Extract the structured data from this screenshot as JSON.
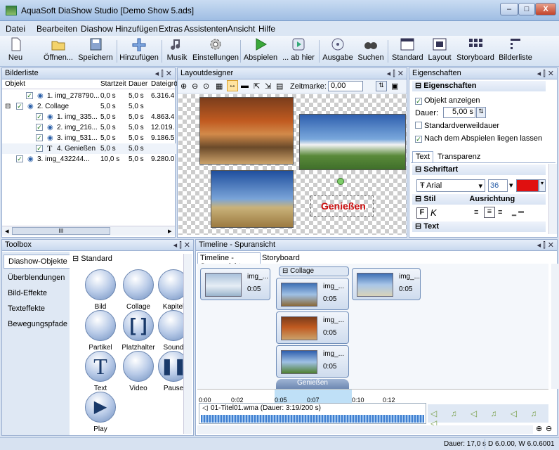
{
  "window": {
    "title": "AquaSoft DiaShow Studio [Demo Show 5.ads]",
    "min": "–",
    "max": "□",
    "close": "X"
  },
  "menu": [
    "Datei",
    "Bearbeiten",
    "Diashow",
    "Hinzufügen",
    "Extras",
    "Assistenten",
    "Ansicht",
    "Hilfe"
  ],
  "toolbar": {
    "neu": "Neu",
    "oeffnen": "Öffnen...",
    "speichern": "Speichern",
    "hinzufuegen": "Hinzufügen",
    "musik": "Musik",
    "einstellungen": "Einstellungen",
    "abspielen": "Abspielen",
    "abhier": "... ab hier",
    "ausgabe": "Ausgabe",
    "suchen": "Suchen",
    "standard": "Standard",
    "layout": "Layout",
    "storyboard": "Storyboard",
    "bilderliste": "Bilderliste"
  },
  "bilderliste": {
    "title": "Bilderliste",
    "controls": "◂ ⫿ ✕",
    "cols": [
      "Objekt",
      "Startzeit",
      "Dauer",
      "Dateigrö"
    ],
    "rows": [
      {
        "name": "1. img_278790...",
        "start": "0,0 s",
        "dur": "5,0 s",
        "size": "6.316.4"
      },
      {
        "name": "2. Collage",
        "start": "5,0 s",
        "dur": "5,0 s",
        "size": ""
      },
      {
        "name": "1. img_335...",
        "start": "5,0 s",
        "dur": "5,0 s",
        "size": "4.863.4"
      },
      {
        "name": "2. img_216...",
        "start": "5,0 s",
        "dur": "5,0 s",
        "size": "12.019."
      },
      {
        "name": "3. img_531...",
        "start": "5,0 s",
        "dur": "5,0 s",
        "size": "9.186.5"
      },
      {
        "name": "4. Genießen",
        "start": "5,0 s",
        "dur": "5,0 s",
        "size": ""
      },
      {
        "name": "3. img_432244...",
        "start": "10,0 s",
        "dur": "5,0 s",
        "size": "9.280.0"
      }
    ],
    "scroll": "III"
  },
  "layoutdesigner": {
    "title": "Layoutdesigner",
    "controls": "◂ ⫿ ✕",
    "zeitmarke_label": "Zeitmarke:",
    "zeitmarke": "0,00",
    "text_object": "Genießen"
  },
  "eigenschaften": {
    "title": "Eigenschaften",
    "controls": "◂ ⫿ ✕",
    "section": "Eigenschaften",
    "objekt_anzeigen": "Objekt anzeigen",
    "dauer_label": "Dauer:",
    "dauer": "5,00 s",
    "standard": "Standardverweildauer",
    "liegen": "Nach dem Abspielen liegen lassen",
    "tab_text": "Text",
    "tab_transparenz": "Transparenz",
    "schriftart": "Schriftart",
    "font": "Arial",
    "size": "36",
    "stil": "Stil",
    "ausrichtung": "Ausrichtung",
    "text": "Text",
    "color": "#e01010"
  },
  "toolbox": {
    "title": "Toolbox",
    "controls": "◂ ⫿ ✕",
    "tabs": [
      "Diashow-Objekte",
      "Überblendungen",
      "Bild-Effekte",
      "Texteffekte",
      "Bewegungspfade"
    ],
    "group": "Standard",
    "tools": [
      "Bild",
      "Collage",
      "Kapitel",
      "Partikel",
      "Platzhalter",
      "Sound",
      "Text",
      "Video",
      "Pause",
      "Play"
    ]
  },
  "timeline": {
    "title": "Timeline - Spuransicht",
    "controls": "◂ ⫿ ✕",
    "tab1": "Timeline - Spuransicht",
    "tab2": "Storyboard",
    "collage": "Collage",
    "clips": [
      {
        "name": "img_...",
        "dur": "0:05"
      },
      {
        "name": "img_...",
        "dur": "0:05"
      },
      {
        "name": "img_...",
        "dur": "0:05"
      },
      {
        "name": "img_...",
        "dur": "0:05"
      },
      {
        "name": "img_...",
        "dur": "0:05"
      }
    ],
    "text_clip": "Genießen",
    "ticks": [
      "0:00",
      "0:02",
      "0:05",
      "0:07",
      "0:10",
      "0:12"
    ],
    "audio": "01-Titel01.wma (Dauer: 3:19/200 s)"
  },
  "status": {
    "dauer": "Dauer: 17,0 s",
    "version": "D 6.0.00, W 6.0.6001"
  }
}
